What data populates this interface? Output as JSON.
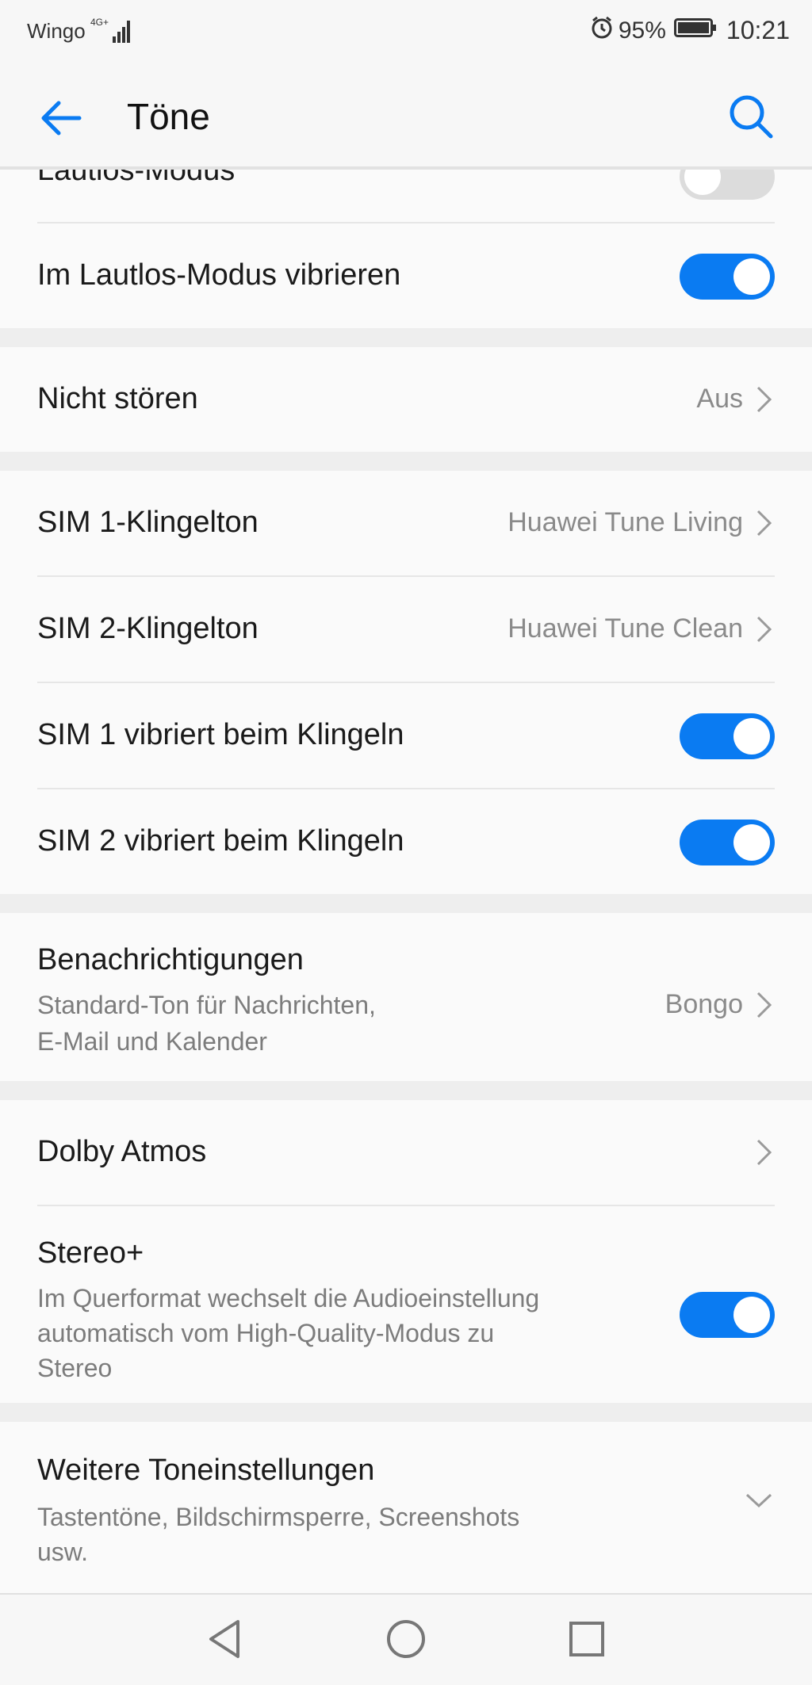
{
  "status": {
    "carrier": "Wingo",
    "network": "4G+",
    "battery_pct": "95%",
    "time": "10:21"
  },
  "appbar": {
    "title": "Töne",
    "back_icon": "arrow-left-icon",
    "search_icon": "search-icon"
  },
  "rows": {
    "silent_mode": {
      "label": "Lautlos-Modus",
      "toggle_on": false
    },
    "vibrate_silent": {
      "label": "Im Lautlos-Modus vibrieren",
      "toggle_on": true
    },
    "dnd": {
      "label": "Nicht stören",
      "value": "Aus"
    },
    "sim1_ringtone": {
      "label": "SIM 1-Klingelton",
      "value": "Huawei Tune Living"
    },
    "sim2_ringtone": {
      "label": "SIM 2-Klingelton",
      "value": "Huawei Tune Clean"
    },
    "sim1_vibrate": {
      "label": "SIM 1 vibriert beim Klingeln",
      "toggle_on": true
    },
    "sim2_vibrate": {
      "label": "SIM 2 vibriert beim Klingeln",
      "toggle_on": true
    },
    "notifications": {
      "label": "Benachrichtigungen",
      "sub_line1": "Standard-Ton für Nachrichten,",
      "sub_line2": "E-Mail und Kalender",
      "value": "Bongo"
    },
    "dolby": {
      "label": "Dolby Atmos"
    },
    "stereo": {
      "label": "Stereo+",
      "sub_line1": "Im Querformat wechselt die Audioeinstellung",
      "sub_line2": "automatisch vom High-Quality-Modus zu",
      "sub_line3": "Stereo",
      "toggle_on": true
    },
    "more": {
      "label": "Weitere Toneinstellungen",
      "sub_line1": "Tastentöne, Bildschirmsperre, Screenshots",
      "sub_line2": "usw."
    }
  },
  "colors": {
    "accent": "#0a7bf2",
    "background": "#f7f7f7",
    "secondary_text": "#7c7c7c"
  }
}
